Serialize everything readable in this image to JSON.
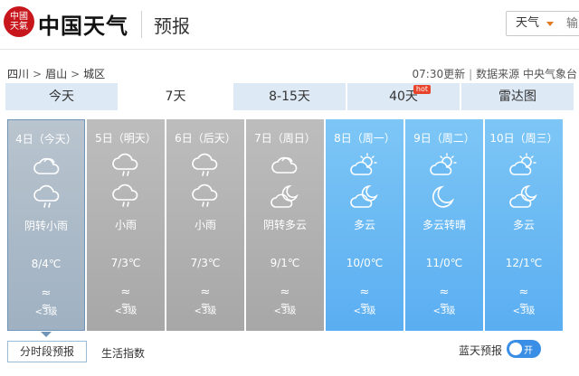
{
  "header": {
    "logo_seal": "中國天氣",
    "logo_text": "中国天气",
    "page_title": "预报",
    "search_select": "天气",
    "search_placeholder": "输"
  },
  "breadcrumb": {
    "province": "四川",
    "city": "眉山",
    "district": "城区",
    "separator": ">"
  },
  "update": {
    "time": "07:30更新",
    "source": "数据来源 中央气象台"
  },
  "tabs": [
    {
      "label": "今天"
    },
    {
      "label": "7天",
      "active": true
    },
    {
      "label": "8-15天"
    },
    {
      "label": "40天",
      "badge": "hot"
    },
    {
      "label": "雷达图"
    }
  ],
  "days": [
    {
      "date": "4日（今天）",
      "icon_day": "cloudy-icon",
      "icon_night": "rain-icon",
      "desc": "阴转小雨",
      "temp": "8/4℃",
      "wind_dir": "≈　≈",
      "wind": "<3级",
      "style": "today"
    },
    {
      "date": "5日（明天）",
      "icon_day": "rain-icon",
      "icon_night": "rain-icon",
      "desc": "小雨",
      "temp": "7/3℃",
      "wind_dir": "≈　≈",
      "wind": "<3级",
      "style": "gray"
    },
    {
      "date": "6日（后天）",
      "icon_day": "rain-icon",
      "icon_night": "rain-icon",
      "desc": "小雨",
      "temp": "7/3℃",
      "wind_dir": "≈　≈",
      "wind": "<3级",
      "style": "gray"
    },
    {
      "date": "7日（周日）",
      "icon_day": "cloudy-icon",
      "icon_night": "moon-cloud-icon",
      "desc": "阴转多云",
      "temp": "9/1℃",
      "wind_dir": "≈　≈",
      "wind": "<3级",
      "style": "gray"
    },
    {
      "date": "8日（周一）",
      "icon_day": "sun-cloud-icon",
      "icon_night": "moon-cloud-icon",
      "desc": "多云",
      "temp": "10/0℃",
      "wind_dir": "≈　≈",
      "wind": "<3级",
      "style": "blue"
    },
    {
      "date": "9日（周二）",
      "icon_day": "sun-cloud-icon",
      "icon_night": "moon-icon",
      "desc": "多云转晴",
      "temp": "11/0℃",
      "wind_dir": "≈　≈",
      "wind": "<3级",
      "style": "blue"
    },
    {
      "date": "10日（周三）",
      "icon_day": "sun-cloud-icon",
      "icon_night": "moon-cloud-icon",
      "desc": "多云",
      "temp": "12/1℃",
      "wind_dir": "≈　≈",
      "wind": "<3级",
      "style": "blue"
    }
  ],
  "bottom": {
    "hourly_button": "分时段预报",
    "life_index": "生活指数",
    "blue_sky_label": "蓝天预报",
    "toggle_state": "开"
  },
  "colors": {
    "today_bg": "#a9b8c7",
    "past_bg": "#b3b3b3",
    "future_bg": "#6bbaf3",
    "toggle": "#3a8ee6",
    "hot": "#e8442c"
  }
}
